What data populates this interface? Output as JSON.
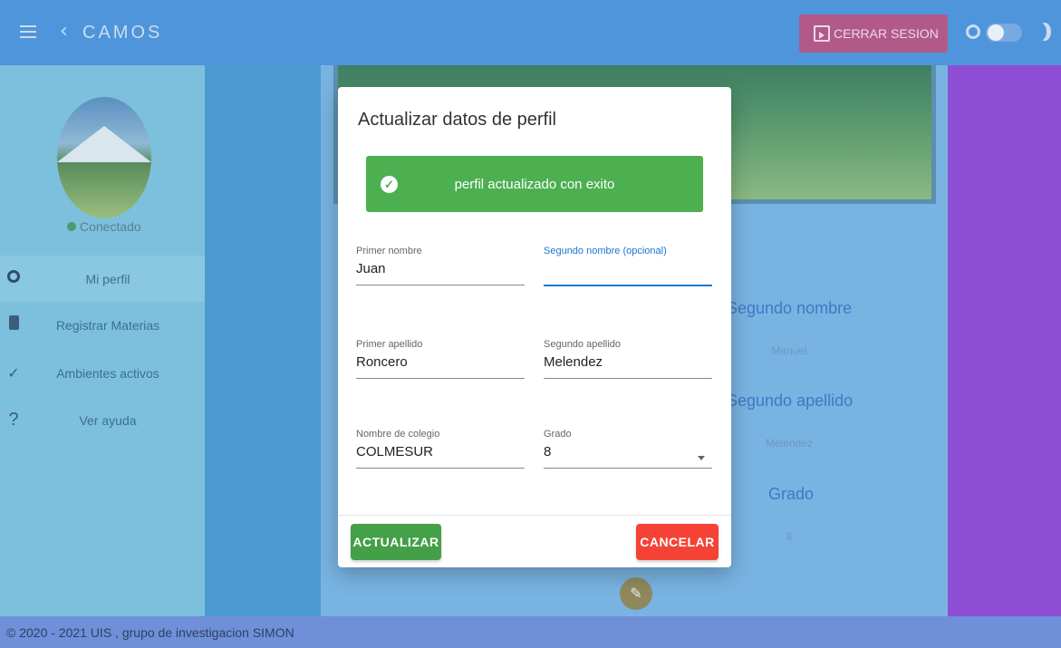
{
  "appbar": {
    "title": "CAMOS",
    "logout_label": "CERRAR SESION",
    "icons": [
      "menu-icon",
      "back-icon",
      "logout-icon",
      "sun-icon",
      "theme-toggle",
      "moon-icon"
    ]
  },
  "sidebar": {
    "status": "Conectado",
    "items": [
      {
        "label": "Mi perfil",
        "icon": "person-icon",
        "active": true
      },
      {
        "label": "Registrar Materias",
        "icon": "book-icon"
      },
      {
        "label": "Ambientes activos",
        "icon": "check-icon"
      },
      {
        "label": "Ver ayuda",
        "icon": "help-icon"
      }
    ]
  },
  "profile_bg": {
    "second_name_label": "Segundo nombre",
    "second_name_value": "Manuel",
    "second_surname_label": "Segundo apellido",
    "second_surname_value": "Melendez",
    "grade_label": "Grado",
    "grade_value": "8"
  },
  "dialog": {
    "title": "Actualizar datos de perfil",
    "alert": "perfil actualizado con exito",
    "fields": {
      "first_name": {
        "label": "Primer nombre",
        "value": "Juan"
      },
      "second_name": {
        "label": "Segundo nombre (opcional)",
        "value": ""
      },
      "first_surname": {
        "label": "Primer apellido",
        "value": "Roncero"
      },
      "second_surname": {
        "label": "Segundo apellido",
        "value": "Melendez"
      },
      "school": {
        "label": "Nombre de colegio",
        "value": "COLMESUR"
      },
      "grade": {
        "label": "Grado",
        "value": "8"
      }
    },
    "update_label": "ACTUALIZAR",
    "cancel_label": "CANCELAR"
  },
  "footer": {
    "text": "© 2020 - 2021 UIS , grupo de investigacion SIMON"
  },
  "colors": {
    "appbar": "#4f95db",
    "alert_success": "#4caf50",
    "update_button": "#43a047",
    "cancel_button": "#f44336",
    "focus": "#1976d2"
  }
}
